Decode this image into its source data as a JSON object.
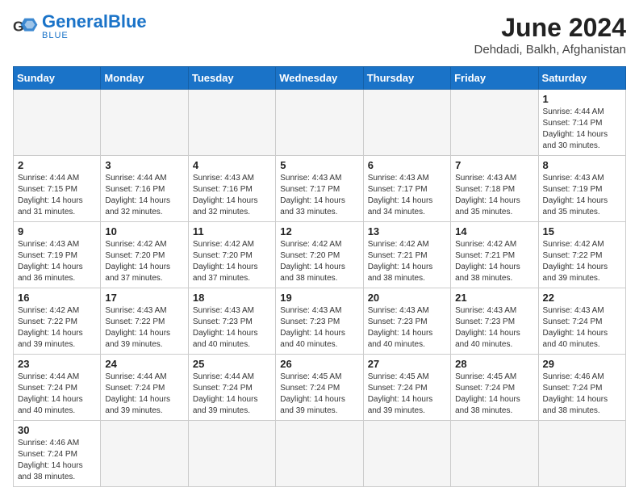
{
  "logo": {
    "text_general": "General",
    "text_blue": "Blue"
  },
  "title": "June 2024",
  "subtitle": "Dehdadi, Balkh, Afghanistan",
  "weekdays": [
    "Sunday",
    "Monday",
    "Tuesday",
    "Wednesday",
    "Thursday",
    "Friday",
    "Saturday"
  ],
  "days": [
    {
      "date": "",
      "info": ""
    },
    {
      "date": "",
      "info": ""
    },
    {
      "date": "",
      "info": ""
    },
    {
      "date": "",
      "info": ""
    },
    {
      "date": "",
      "info": ""
    },
    {
      "date": "",
      "info": ""
    },
    {
      "date": "1",
      "info": "Sunrise: 4:44 AM\nSunset: 7:14 PM\nDaylight: 14 hours and 30 minutes."
    },
    {
      "date": "2",
      "info": "Sunrise: 4:44 AM\nSunset: 7:15 PM\nDaylight: 14 hours and 31 minutes."
    },
    {
      "date": "3",
      "info": "Sunrise: 4:44 AM\nSunset: 7:16 PM\nDaylight: 14 hours and 32 minutes."
    },
    {
      "date": "4",
      "info": "Sunrise: 4:43 AM\nSunset: 7:16 PM\nDaylight: 14 hours and 32 minutes."
    },
    {
      "date": "5",
      "info": "Sunrise: 4:43 AM\nSunset: 7:17 PM\nDaylight: 14 hours and 33 minutes."
    },
    {
      "date": "6",
      "info": "Sunrise: 4:43 AM\nSunset: 7:17 PM\nDaylight: 14 hours and 34 minutes."
    },
    {
      "date": "7",
      "info": "Sunrise: 4:43 AM\nSunset: 7:18 PM\nDaylight: 14 hours and 35 minutes."
    },
    {
      "date": "8",
      "info": "Sunrise: 4:43 AM\nSunset: 7:19 PM\nDaylight: 14 hours and 35 minutes."
    },
    {
      "date": "9",
      "info": "Sunrise: 4:43 AM\nSunset: 7:19 PM\nDaylight: 14 hours and 36 minutes."
    },
    {
      "date": "10",
      "info": "Sunrise: 4:42 AM\nSunset: 7:20 PM\nDaylight: 14 hours and 37 minutes."
    },
    {
      "date": "11",
      "info": "Sunrise: 4:42 AM\nSunset: 7:20 PM\nDaylight: 14 hours and 37 minutes."
    },
    {
      "date": "12",
      "info": "Sunrise: 4:42 AM\nSunset: 7:20 PM\nDaylight: 14 hours and 38 minutes."
    },
    {
      "date": "13",
      "info": "Sunrise: 4:42 AM\nSunset: 7:21 PM\nDaylight: 14 hours and 38 minutes."
    },
    {
      "date": "14",
      "info": "Sunrise: 4:42 AM\nSunset: 7:21 PM\nDaylight: 14 hours and 38 minutes."
    },
    {
      "date": "15",
      "info": "Sunrise: 4:42 AM\nSunset: 7:22 PM\nDaylight: 14 hours and 39 minutes."
    },
    {
      "date": "16",
      "info": "Sunrise: 4:42 AM\nSunset: 7:22 PM\nDaylight: 14 hours and 39 minutes."
    },
    {
      "date": "17",
      "info": "Sunrise: 4:43 AM\nSunset: 7:22 PM\nDaylight: 14 hours and 39 minutes."
    },
    {
      "date": "18",
      "info": "Sunrise: 4:43 AM\nSunset: 7:23 PM\nDaylight: 14 hours and 40 minutes."
    },
    {
      "date": "19",
      "info": "Sunrise: 4:43 AM\nSunset: 7:23 PM\nDaylight: 14 hours and 40 minutes."
    },
    {
      "date": "20",
      "info": "Sunrise: 4:43 AM\nSunset: 7:23 PM\nDaylight: 14 hours and 40 minutes."
    },
    {
      "date": "21",
      "info": "Sunrise: 4:43 AM\nSunset: 7:23 PM\nDaylight: 14 hours and 40 minutes."
    },
    {
      "date": "22",
      "info": "Sunrise: 4:43 AM\nSunset: 7:24 PM\nDaylight: 14 hours and 40 minutes."
    },
    {
      "date": "23",
      "info": "Sunrise: 4:44 AM\nSunset: 7:24 PM\nDaylight: 14 hours and 40 minutes."
    },
    {
      "date": "24",
      "info": "Sunrise: 4:44 AM\nSunset: 7:24 PM\nDaylight: 14 hours and 39 minutes."
    },
    {
      "date": "25",
      "info": "Sunrise: 4:44 AM\nSunset: 7:24 PM\nDaylight: 14 hours and 39 minutes."
    },
    {
      "date": "26",
      "info": "Sunrise: 4:45 AM\nSunset: 7:24 PM\nDaylight: 14 hours and 39 minutes."
    },
    {
      "date": "27",
      "info": "Sunrise: 4:45 AM\nSunset: 7:24 PM\nDaylight: 14 hours and 39 minutes."
    },
    {
      "date": "28",
      "info": "Sunrise: 4:45 AM\nSunset: 7:24 PM\nDaylight: 14 hours and 38 minutes."
    },
    {
      "date": "29",
      "info": "Sunrise: 4:46 AM\nSunset: 7:24 PM\nDaylight: 14 hours and 38 minutes."
    },
    {
      "date": "30",
      "info": "Sunrise: 4:46 AM\nSunset: 7:24 PM\nDaylight: 14 hours and 38 minutes."
    }
  ]
}
